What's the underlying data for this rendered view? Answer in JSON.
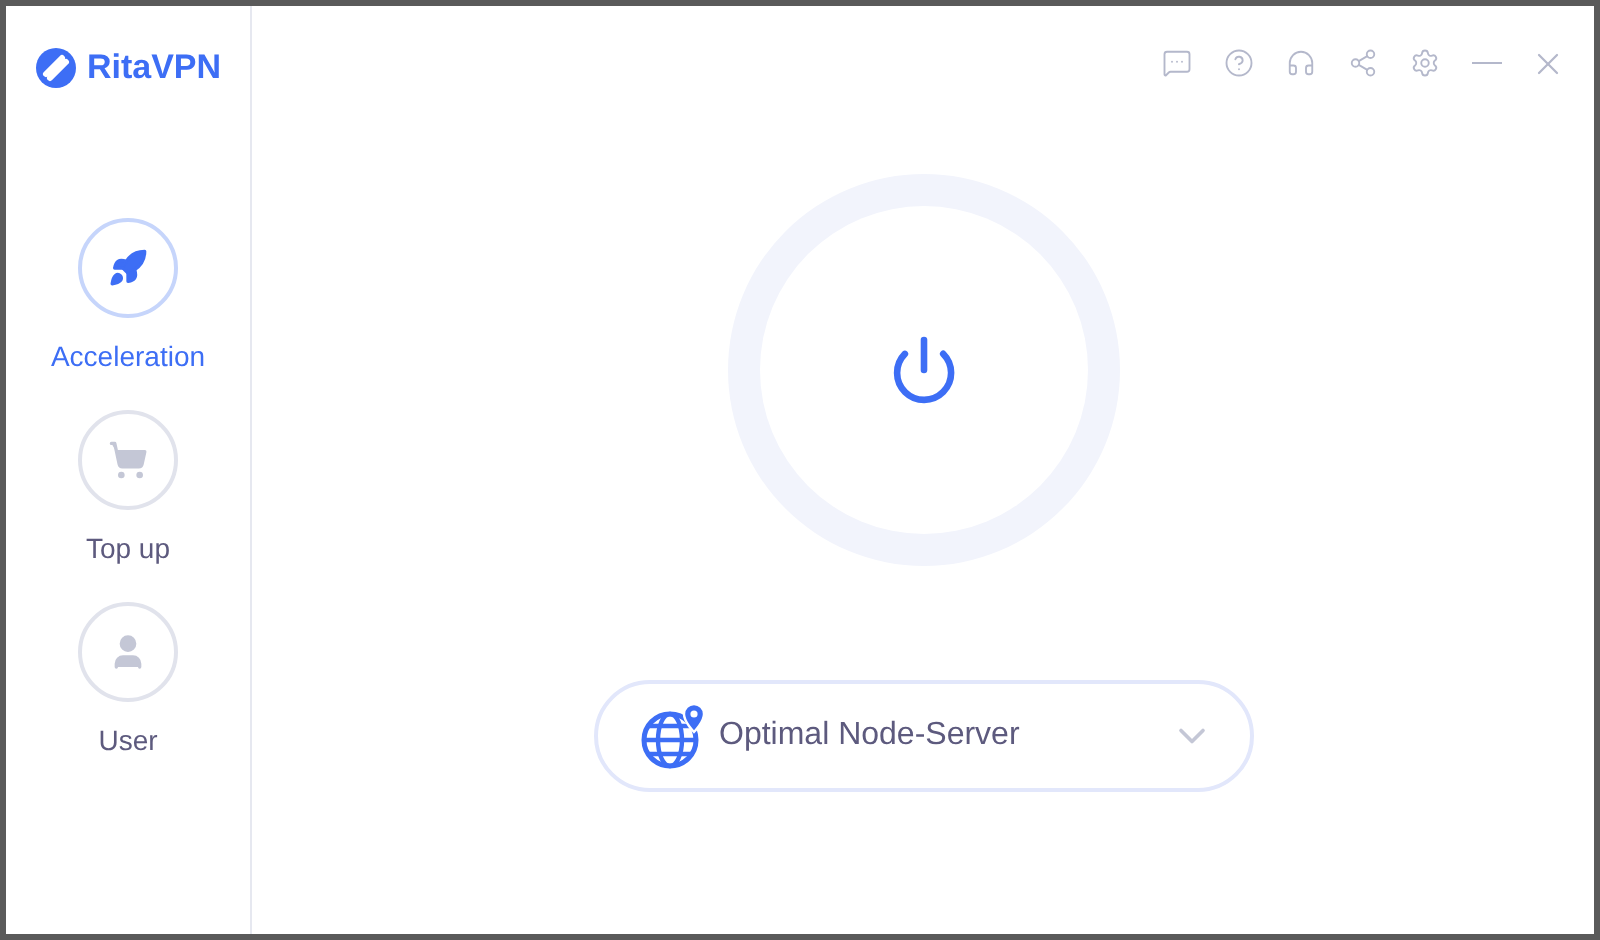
{
  "logo": {
    "text": "RitaVPN"
  },
  "nav": [
    {
      "kind": "rocket",
      "label": "Acceleration",
      "selected": true
    },
    {
      "kind": "cart",
      "label": "Top up",
      "selected": false
    },
    {
      "kind": "user",
      "label": "User",
      "selected": false
    }
  ],
  "toolbar": [
    {
      "kind": "message"
    },
    {
      "kind": "help"
    },
    {
      "kind": "support"
    },
    {
      "kind": "share"
    },
    {
      "kind": "settings"
    },
    {
      "kind": "minimize"
    },
    {
      "kind": "close"
    }
  ],
  "power": {
    "on": false
  },
  "server": {
    "value": "Optimal Node-Server"
  }
}
